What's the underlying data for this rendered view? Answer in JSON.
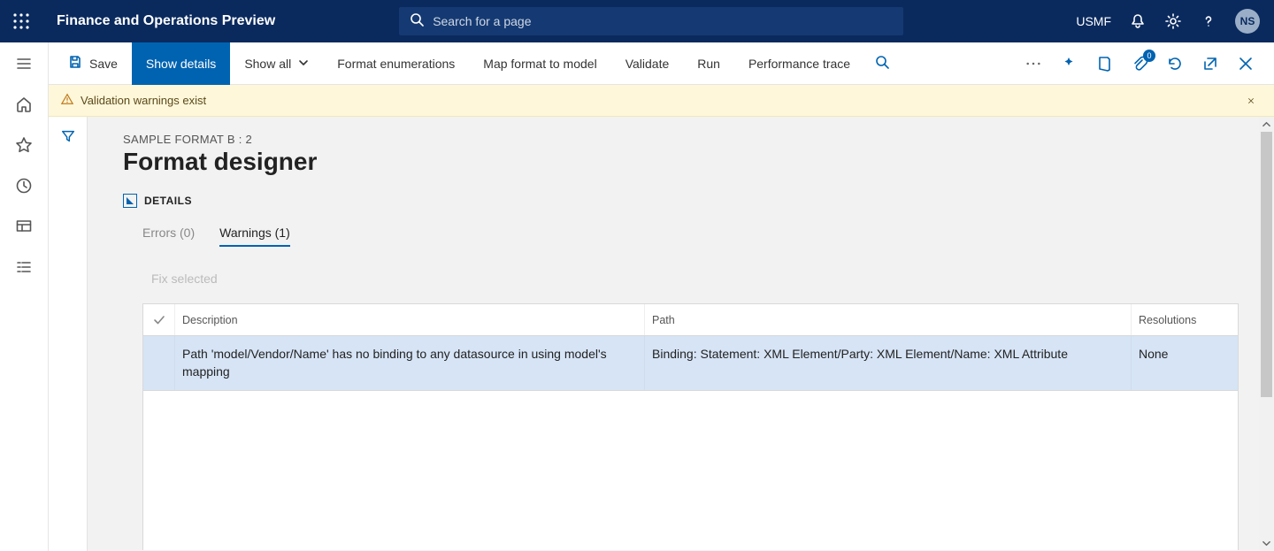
{
  "header": {
    "app_title": "Finance and Operations Preview",
    "search_placeholder": "Search for a page",
    "legal_entity": "USMF",
    "avatar_initials": "NS"
  },
  "actionbar": {
    "save": "Save",
    "show_details": "Show details",
    "show_all": "Show all",
    "format_enumerations": "Format enumerations",
    "map_format": "Map format to model",
    "validate": "Validate",
    "run": "Run",
    "performance_trace": "Performance trace",
    "attachments_count": "0"
  },
  "banner": {
    "text": "Validation warnings exist"
  },
  "page": {
    "breadcrumb": "SAMPLE FORMAT B : 2",
    "title": "Format designer",
    "details_label": "DETAILS"
  },
  "tabs": {
    "errors": "Errors (0)",
    "warnings": "Warnings (1)"
  },
  "toolbar": {
    "fix_selected": "Fix selected"
  },
  "grid": {
    "columns": {
      "description": "Description",
      "path": "Path",
      "resolutions": "Resolutions"
    },
    "rows": [
      {
        "description": "Path 'model/Vendor/Name' has no binding to any datasource in using model's mapping",
        "path": "Binding: Statement: XML Element/Party: XML Element/Name: XML Attribute",
        "resolutions": "None"
      }
    ]
  }
}
